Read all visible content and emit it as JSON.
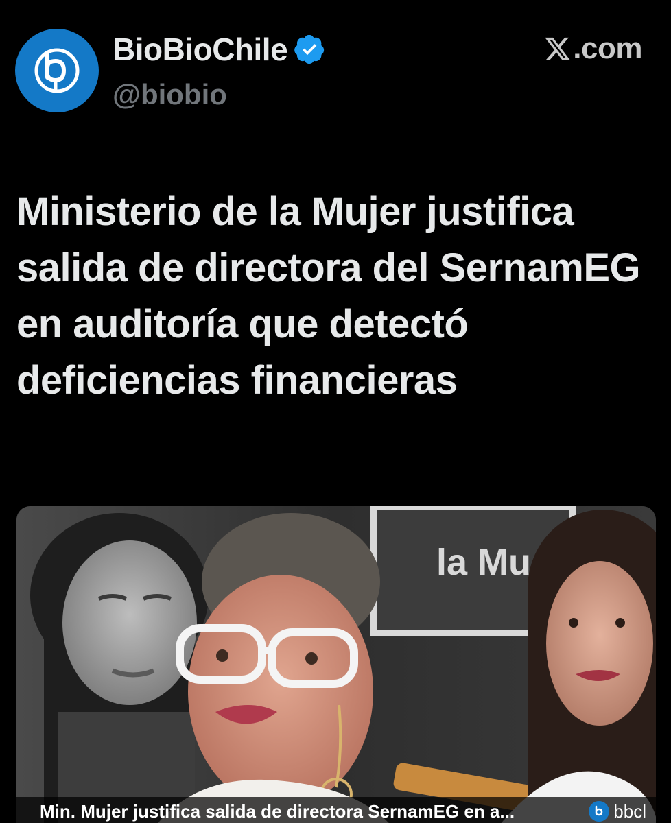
{
  "account": {
    "display_name": "BioBioChile",
    "handle": "@biobio",
    "avatar_icon": "biobio-logo-icon",
    "verified_icon": "verified-badge-icon",
    "verified_color": "#1d9bf0",
    "avatar_color": "#1479c7"
  },
  "site": {
    "label": ".com",
    "icon": "x-logo-icon"
  },
  "post": {
    "headline": "Ministerio de la Mujer justifica salida de directora del SernamEG en auditoría que detectó deficiencias financieras"
  },
  "media": {
    "backdrop_text": "la Mu",
    "caption": "Min. Mujer justifica salida de directora SernamEG en a...",
    "domain": "bbcl",
    "domain_icon": "biobio-mini-logo-icon"
  }
}
